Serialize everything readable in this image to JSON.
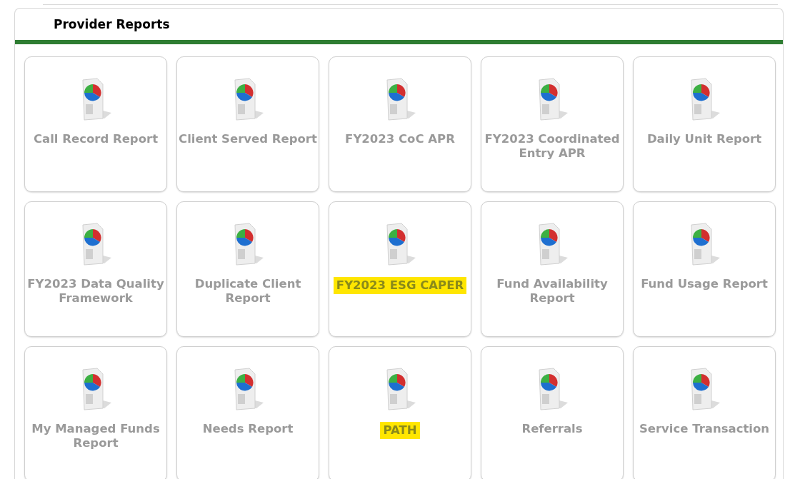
{
  "panel": {
    "title": "Provider Reports"
  },
  "reports": [
    {
      "label": "Call Record Report",
      "highlighted": false
    },
    {
      "label": "Client Served Report",
      "highlighted": false
    },
    {
      "label": "FY2023 CoC APR",
      "highlighted": false
    },
    {
      "label": "FY2023 Coordinated Entry APR",
      "highlighted": false
    },
    {
      "label": "Daily Unit Report",
      "highlighted": false
    },
    {
      "label": "FY2023 Data Quality Framework",
      "highlighted": false
    },
    {
      "label": "Duplicate Client Report",
      "highlighted": false
    },
    {
      "label": "FY2023 ESG CAPER",
      "highlighted": true
    },
    {
      "label": "Fund Availability Report",
      "highlighted": false
    },
    {
      "label": "Fund Usage Report",
      "highlighted": false
    },
    {
      "label": "My Managed Funds Report",
      "highlighted": false
    },
    {
      "label": "Needs Report",
      "highlighted": false
    },
    {
      "label": "PATH",
      "highlighted": true
    },
    {
      "label": "Referrals",
      "highlighted": false
    },
    {
      "label": "Service Transaction",
      "highlighted": false
    }
  ]
}
